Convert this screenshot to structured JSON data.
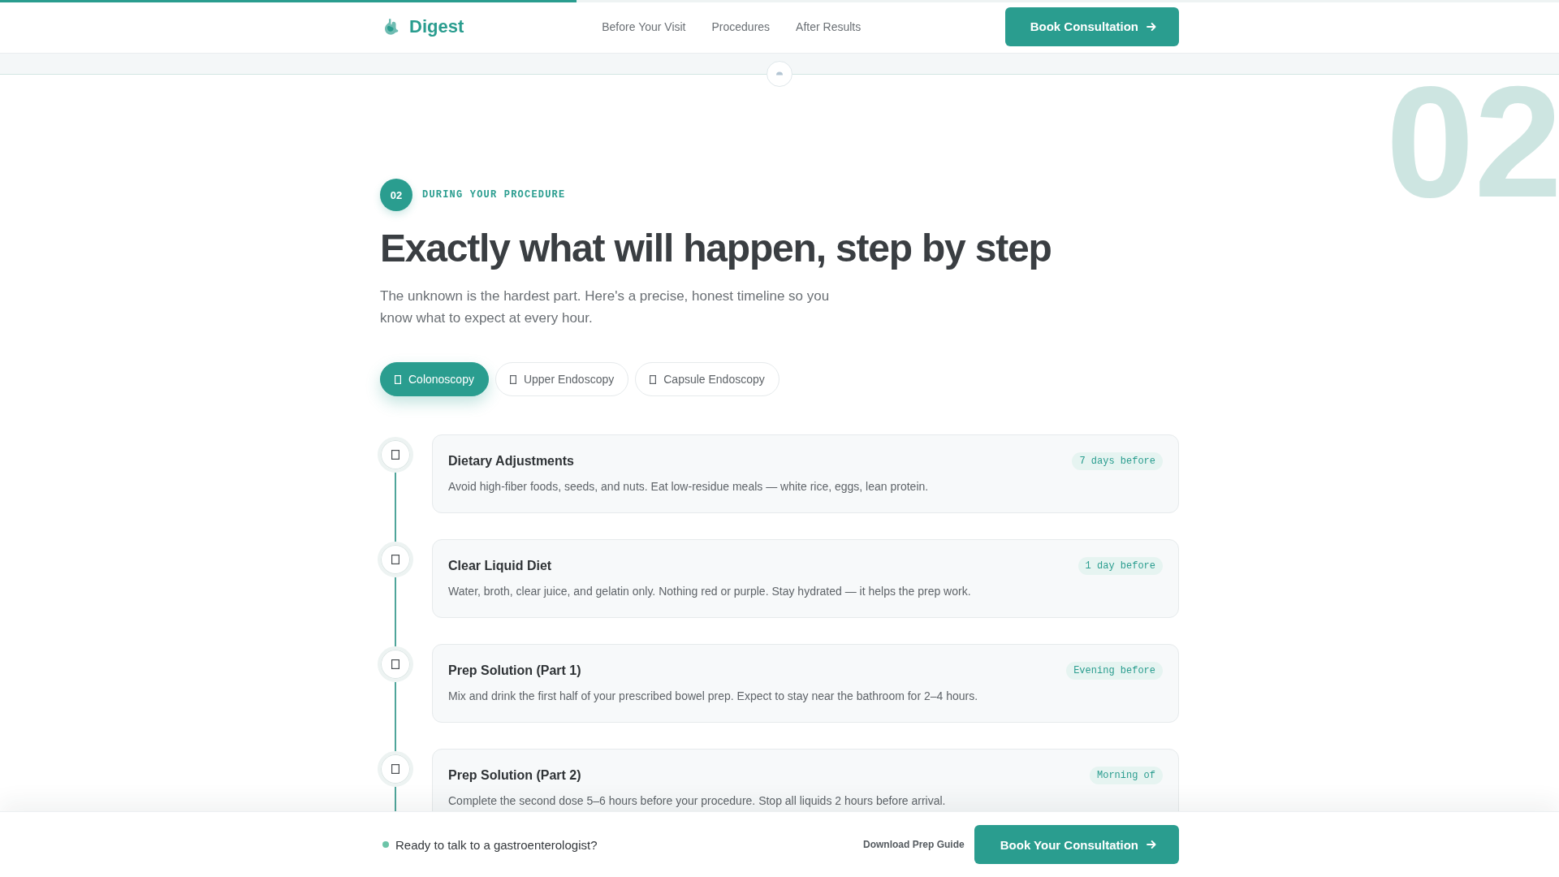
{
  "reading_progress": {
    "level": 0.37
  },
  "header": {
    "logo": "Digest",
    "nav": [
      {
        "label": "Before Your Visit"
      },
      {
        "label": "Procedures"
      },
      {
        "label": "After Results"
      }
    ],
    "cta": "Book Consultation"
  },
  "section": {
    "background_number": "02",
    "step_number": "02",
    "eyebrow": "DURING YOUR PROCEDURE",
    "title": "Exactly what will happen, step by step",
    "intro": "The unknown is the hardest part. Here's a precise, honest timeline so you know what to expect at every hour."
  },
  "procedure_tabs": [
    {
      "label": "Colonoscopy",
      "selected": true
    },
    {
      "label": "Upper Endoscopy",
      "selected": false
    },
    {
      "label": "Capsule Endoscopy",
      "selected": false
    }
  ],
  "timeline": [
    {
      "title": "Dietary Adjustments",
      "timing": "7 days before",
      "description": "Avoid high-fiber foods, seeds, and nuts. Eat low-residue meals — white rice, eggs, lean protein."
    },
    {
      "title": "Clear Liquid Diet",
      "timing": "1 day before",
      "description": "Water, broth, clear juice, and gelatin only. Nothing red or purple. Stay hydrated — it helps the prep work."
    },
    {
      "title": "Prep Solution (Part 1)",
      "timing": "Evening before",
      "description": "Mix and drink the first half of your prescribed bowel prep. Expect to stay near the bathroom for 2–4 hours."
    },
    {
      "title": "Prep Solution (Part 2)",
      "timing": "Morning of",
      "description": "Complete the second dose 5–6 hours before your procedure. Stop all liquids 2 hours before arrival."
    }
  ],
  "bottom_bar": {
    "prompt": "Ready to talk to a gastroenterologist?",
    "secondary_link": "Download Prep Guide",
    "cta": "Book Your Consultation"
  }
}
